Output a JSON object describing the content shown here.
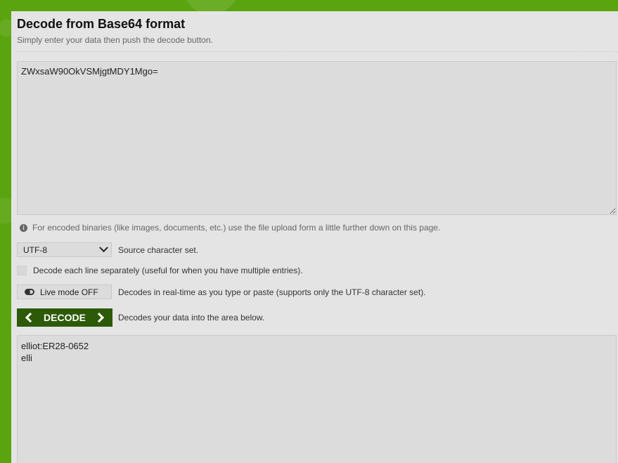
{
  "header": {
    "title": "Decode from Base64 format",
    "subtitle": "Simply enter your data then push the decode button."
  },
  "input": {
    "value": "ZWxsaW90OkVSMjgtMDY1Mgo="
  },
  "info": {
    "text": "For encoded binaries (like images, documents, etc.) use the file upload form a little further down on this page."
  },
  "charset": {
    "selected": "UTF-8",
    "label": "Source character set."
  },
  "separate_lines": {
    "checked": false,
    "label": "Decode each line separately (useful for when you have multiple entries)."
  },
  "live_mode": {
    "button_label": "Live mode OFF",
    "description": "Decodes in real-time as you type or paste (supports only the UTF-8 character set)."
  },
  "decode": {
    "button_label": "DECODE",
    "description": "Decodes your data into the area below."
  },
  "output": {
    "value": "elliot:ER28-0652\nelli"
  },
  "colors": {
    "background_green": "#5aa40f",
    "panel": "#e4e4e4",
    "decode_button": "#2c5a08"
  }
}
